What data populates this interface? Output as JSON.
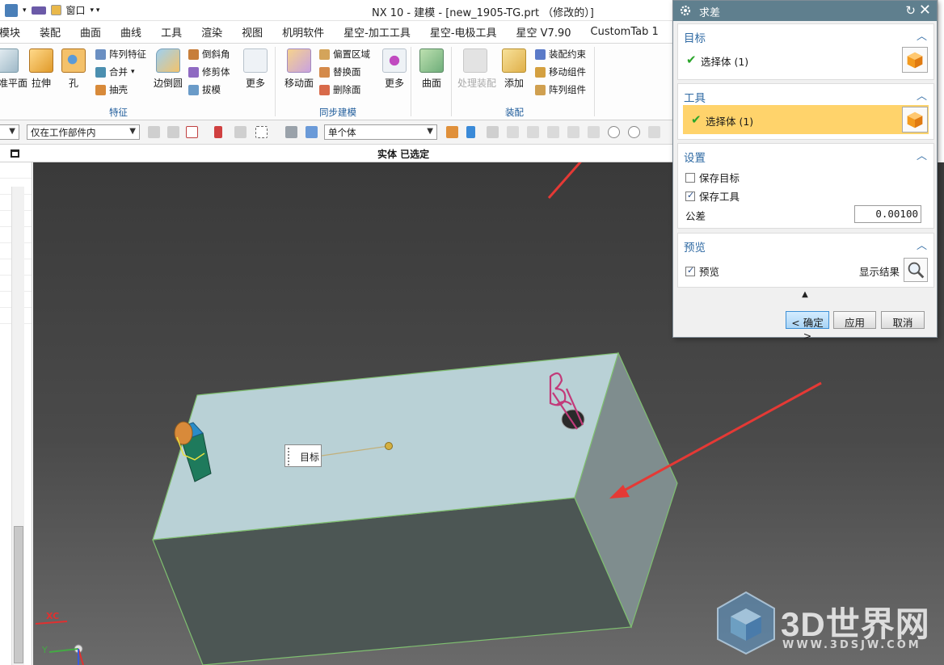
{
  "window": {
    "title": "NX 10 - 建模 - [new_1905-TG.prt （修改的）]",
    "quick_access": {
      "window_menu": "窗口"
    }
  },
  "menu_tabs": [
    "用模块",
    "装配",
    "曲面",
    "曲线",
    "工具",
    "渲染",
    "视图",
    "机明软件",
    "星空-加工工具",
    "星空-电极工具",
    "星空 V7.90",
    "CustomTab 1"
  ],
  "ribbon": {
    "feature": {
      "big_buttons": [
        "基准平面",
        "拉伸",
        "孔"
      ],
      "small_col1": [
        "阵列特征",
        "合并",
        "抽壳"
      ],
      "big2": "边倒圆",
      "small_col2": [
        "倒斜角",
        "修剪体",
        "拔模"
      ],
      "more": "更多",
      "group_label": "特征"
    },
    "sync": {
      "big": "移动面",
      "small": [
        "偏置区域",
        "替换面",
        "删除面"
      ],
      "more": "更多",
      "group_label": "同步建模"
    },
    "surface": {
      "big": "曲面"
    },
    "assembly": {
      "big1": "处理装配",
      "big2": "添加",
      "small": [
        "装配约束",
        "移动组件",
        "阵列组件"
      ],
      "group_label": "装配"
    }
  },
  "selection_bar": {
    "scope_value": "仅在工作部件内",
    "type_value": "单个体"
  },
  "status_text": "实体 已选定",
  "viewport": {
    "callout_label": "目标",
    "axis_x": "XC",
    "axis_y": "Y"
  },
  "watermark": {
    "brand": "3D世界网",
    "url": "WWW.3DSJW.COM"
  },
  "dialog": {
    "title": "求差",
    "target": {
      "header": "目标",
      "select_label": "选择体 (1)"
    },
    "tool": {
      "header": "工具",
      "select_label": "选择体 (1)"
    },
    "settings": {
      "header": "设置",
      "keep_target": "保存目标",
      "keep_target_checked": false,
      "keep_tool": "保存工具",
      "keep_tool_checked": true,
      "tolerance_label": "公差",
      "tolerance_value": "0.00100"
    },
    "preview": {
      "header": "预览",
      "preview_label": "预览",
      "preview_checked": true,
      "show_result": "显示结果"
    },
    "buttons": {
      "ok": "< 确定 >",
      "apply": "应用",
      "cancel": "取消"
    }
  },
  "colors": {
    "dialog_title_bg": "#5f7f8e",
    "section_header": "#2f6aa3",
    "active_selection": "#ffd36b",
    "block_top": "#b9d1d6",
    "annotation_arrow": "#e53935"
  }
}
